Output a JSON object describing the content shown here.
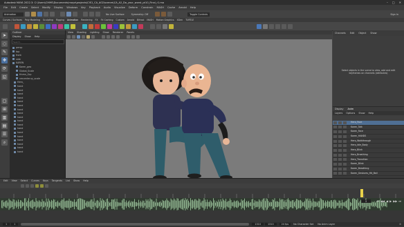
{
  "window": {
    "title": "Autodesk MAYA 2022.3: C:\\Users\\CHMS\\Documents\\maya\\projects\\CIS1_CA_A02\\scenes\\CA_A2_Do_your_worst_pt10_Final_r1.ma"
  },
  "menubar": {
    "items": [
      "File",
      "Edit",
      "Create",
      "Select",
      "Modify",
      "Display",
      "Windows",
      "Key",
      "Playback",
      "Audio",
      "Visualize",
      "Deform",
      "Constrain",
      "MASH",
      "Cache",
      "Arnold",
      "Help"
    ]
  },
  "statusline": {
    "mode": "Animation",
    "no_live_surface": "No Live Surface",
    "symmetry": "Symmetry: Off",
    "sign_in": "Sign In",
    "toggle": "Toggle Controls"
  },
  "shelf": {
    "tabs": [
      "Curves / Surfaces",
      "Poly Modeling",
      "Sculpting",
      "Rigging",
      "Animation",
      "Rendering",
      "FX",
      "FX Caching",
      "Custom",
      "Arnold",
      "Bifrost",
      "MASH",
      "Motion Graphics",
      "XGen",
      "TURTLE"
    ]
  },
  "outliner": {
    "title": "Outliner",
    "menu": [
      "Display",
      "Show",
      "Help"
    ],
    "search_placeholder": "Search...",
    "items": [
      "persp",
      "top",
      "front",
      "side",
      "KAREN",
      "Karen_geo",
      "Global_Scale",
      "Hnmn_Grp",
      "vmcenteruy_scale",
      "Hero_",
      "hand",
      "hand",
      "hand",
      "hand",
      "hand",
      "hand",
      "hand",
      "hand",
      "hand",
      "hand",
      "hand",
      "hand",
      "hand",
      "hand",
      "hand",
      "hand",
      "hand",
      "hand"
    ]
  },
  "viewport": {
    "menu": [
      "View",
      "Shading",
      "Lighting",
      "Show",
      "Renderer",
      "Panels"
    ]
  },
  "channelbox": {
    "tabs": [
      "Channels",
      "Edit",
      "Object",
      "Show"
    ],
    "message": "Select objects in the scene to view, add and edit keyframes on channels (attributes)"
  },
  "layers": {
    "tabs": [
      "Display",
      "Anim"
    ],
    "menu": [
      "Layers",
      "Options",
      "Show",
      "Help"
    ],
    "items": [
      "Hero_Face",
      "Karen_Talk",
      "Karen_Face",
      "Karen_HANDS",
      "Hero_Walkthrough",
      "Hero_Idle_Body",
      "Hero_Blink",
      "Hero_Breathing",
      "Hero_Transition",
      "Karen_Blink",
      "Karen_Breathing",
      "Karen_Gestures_Hit_Ball"
    ]
  },
  "timeline": {
    "menu": [
      "Edit",
      "View",
      "Select",
      "Curves",
      "Keys",
      "Tangents",
      "List",
      "Show",
      "Help"
    ],
    "current_frame": "1",
    "start": "1",
    "end": "1310",
    "no_char_set": "No Character Set",
    "no_anim_layer": "No Anim Layer",
    "fps": "24 fps"
  }
}
